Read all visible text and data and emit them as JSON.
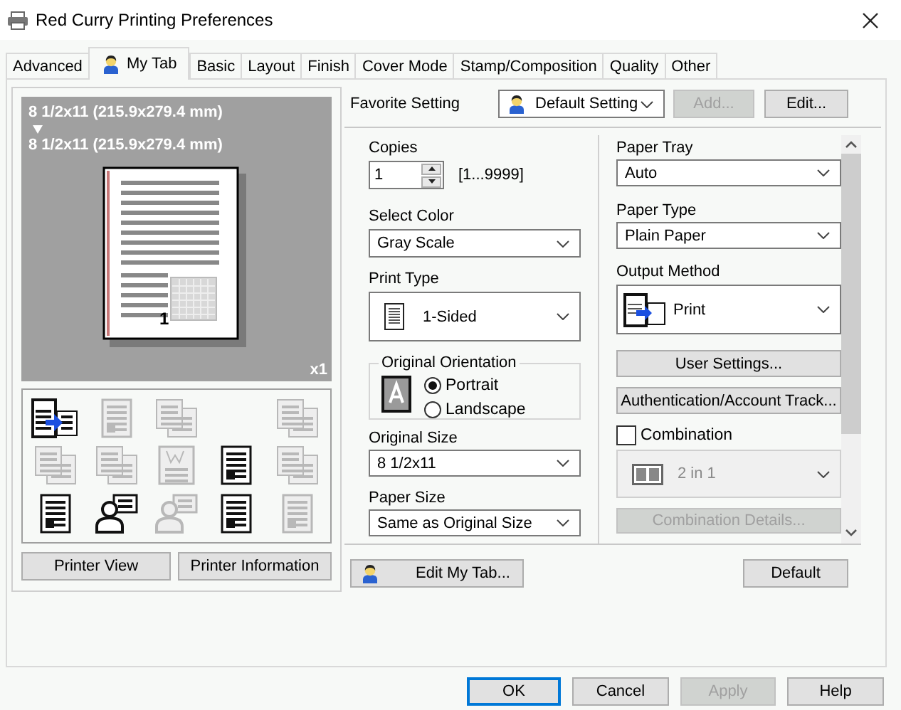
{
  "window": {
    "title": "Red Curry Printing Preferences"
  },
  "tabs": [
    {
      "label": "Advanced",
      "selected": false,
      "has_icon": false
    },
    {
      "label": "My Tab",
      "selected": true,
      "has_icon": true
    },
    {
      "label": "Basic",
      "selected": false,
      "has_icon": false
    },
    {
      "label": "Layout",
      "selected": false,
      "has_icon": false
    },
    {
      "label": "Finish",
      "selected": false,
      "has_icon": false
    },
    {
      "label": "Cover Mode",
      "selected": false,
      "has_icon": false
    },
    {
      "label": "Stamp/Composition",
      "selected": false,
      "has_icon": false
    },
    {
      "label": "Quality",
      "selected": false,
      "has_icon": false
    },
    {
      "label": "Other",
      "selected": false,
      "has_icon": false
    }
  ],
  "preview": {
    "original_size": "8 1/2x11 (215.9x279.4 mm)",
    "output_size": "8 1/2x11 (215.9x279.4 mm)",
    "page_number": "1",
    "copies": "x1"
  },
  "function_icons": [
    {
      "kind": "icon",
      "disabled": false
    },
    {
      "kind": "icon",
      "disabled": true
    },
    {
      "kind": "icon",
      "disabled": true
    },
    {
      "kind": "blank"
    },
    {
      "kind": "icon",
      "disabled": true
    },
    {
      "kind": "icon",
      "disabled": true
    },
    {
      "kind": "icon",
      "disabled": true
    },
    {
      "kind": "icon",
      "disabled": true
    },
    {
      "kind": "icon",
      "disabled": false
    },
    {
      "kind": "icon",
      "disabled": true
    },
    {
      "kind": "icon",
      "disabled": false
    },
    {
      "kind": "icon",
      "disabled": false
    },
    {
      "kind": "icon",
      "disabled": true
    },
    {
      "kind": "icon",
      "disabled": false
    },
    {
      "kind": "icon",
      "disabled": true
    }
  ],
  "left_buttons": [
    "Printer View",
    "Printer Information"
  ],
  "favorite": {
    "label": "Favorite Setting",
    "value": "Default Setting",
    "buttons": [
      {
        "label": "Add...",
        "disabled": true
      },
      {
        "label": "Edit...",
        "disabled": false
      }
    ]
  },
  "copies": {
    "label": "Copies",
    "value": "1",
    "range": "[1...9999]"
  },
  "select_color": {
    "label": "Select Color",
    "value": "Gray Scale"
  },
  "print_type": {
    "label": "Print Type",
    "value": "1-Sided"
  },
  "original_orientation": {
    "label": "Original Orientation",
    "options": [
      {
        "label": "Portrait",
        "selected": true
      },
      {
        "label": "Landscape",
        "selected": false
      }
    ]
  },
  "original_size": {
    "label": "Original Size",
    "value": "8 1/2x11"
  },
  "paper_size": {
    "label": "Paper Size",
    "value": "Same as Original Size"
  },
  "paper_tray": {
    "label": "Paper Tray",
    "value": "Auto"
  },
  "paper_type": {
    "label": "Paper Type",
    "value": "Plain Paper"
  },
  "output_method": {
    "label": "Output Method",
    "value": "Print"
  },
  "user_settings_button": "User Settings...",
  "authentication_button": "Authentication/Account Track...",
  "combination": {
    "label": "Combination",
    "checked": false,
    "value": "2 in 1",
    "disabled": true,
    "details_button": "Combination Details...",
    "details_disabled": true
  },
  "edit_my_tab_button": "Edit My Tab...",
  "default_button": "Default",
  "footer_buttons": [
    {
      "label": "OK",
      "default": true,
      "disabled": false
    },
    {
      "label": "Cancel",
      "default": false,
      "disabled": false
    },
    {
      "label": "Apply",
      "default": false,
      "disabled": true
    },
    {
      "label": "Help",
      "default": false,
      "disabled": false
    }
  ]
}
